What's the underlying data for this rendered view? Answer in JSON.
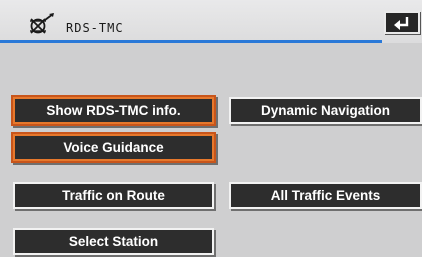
{
  "header": {
    "title": "RDS-TMC",
    "icon": "rds-tmc-icon",
    "back_icon": "return-arrow-icon",
    "rule_color": "#2a79d8"
  },
  "buttons": {
    "show_rds_tmc_info": "Show RDS-TMC info.",
    "dynamic_navigation": "Dynamic Navigation",
    "voice_guidance": "Voice Guidance",
    "traffic_on_route": "Traffic on Route",
    "all_traffic_events": "All Traffic Events",
    "select_station": "Select Station"
  },
  "colors": {
    "background": "#cfcfd0",
    "button_fill": "#2d2d2d",
    "highlight_border": "#e6782c"
  }
}
